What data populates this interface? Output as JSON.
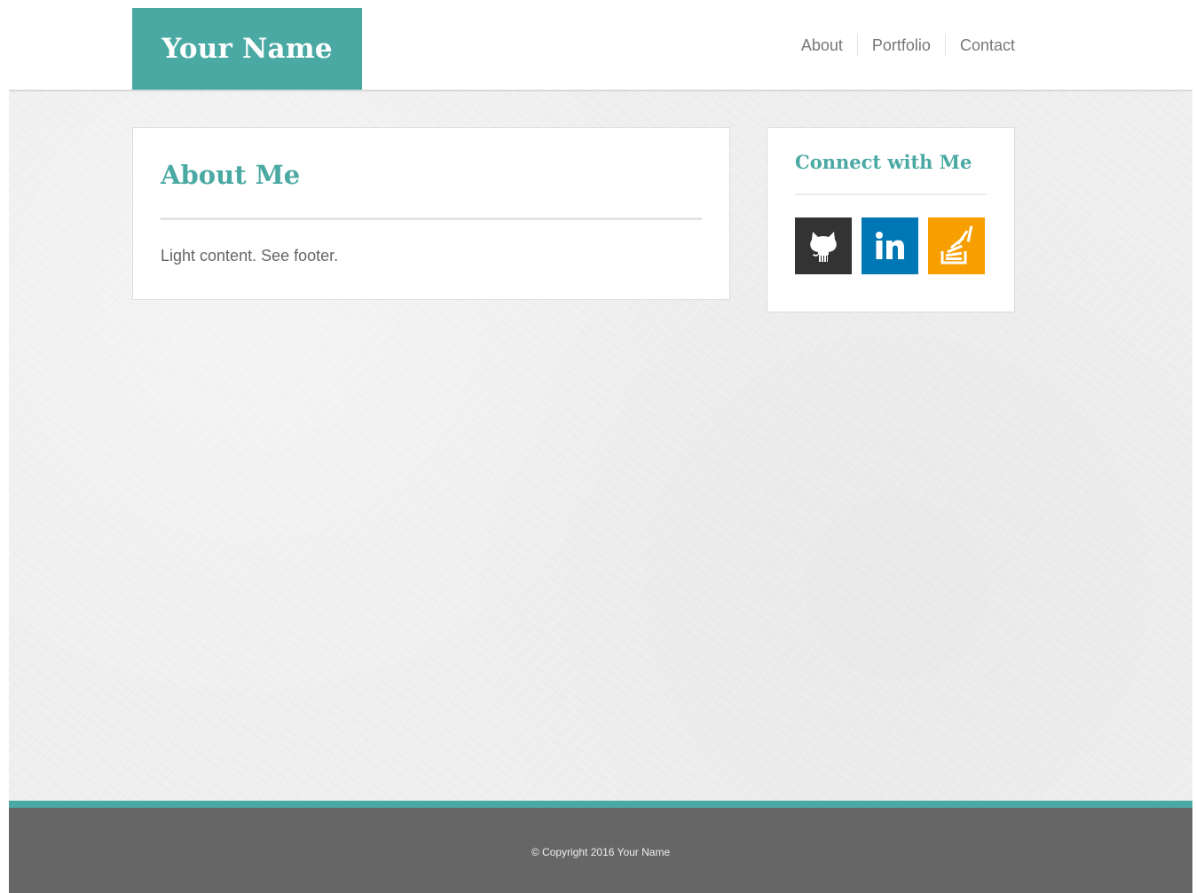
{
  "colors": {
    "accent": "#4aa9a3",
    "footer_bg": "#666666",
    "github": "#333333",
    "linkedin": "#0077b5",
    "stackoverflow": "#f79f00"
  },
  "header": {
    "brand": "Your Name",
    "nav": [
      {
        "label": "About"
      },
      {
        "label": "Portfolio"
      },
      {
        "label": "Contact"
      }
    ]
  },
  "about": {
    "title": "About Me",
    "text": "Light content. See footer."
  },
  "connect": {
    "title": "Connect with Me",
    "links": [
      {
        "icon": "github-icon"
      },
      {
        "icon": "linkedin-icon"
      },
      {
        "icon": "stackoverflow-icon"
      }
    ]
  },
  "footer": {
    "copyright": "© Copyright 2016 Your Name"
  }
}
